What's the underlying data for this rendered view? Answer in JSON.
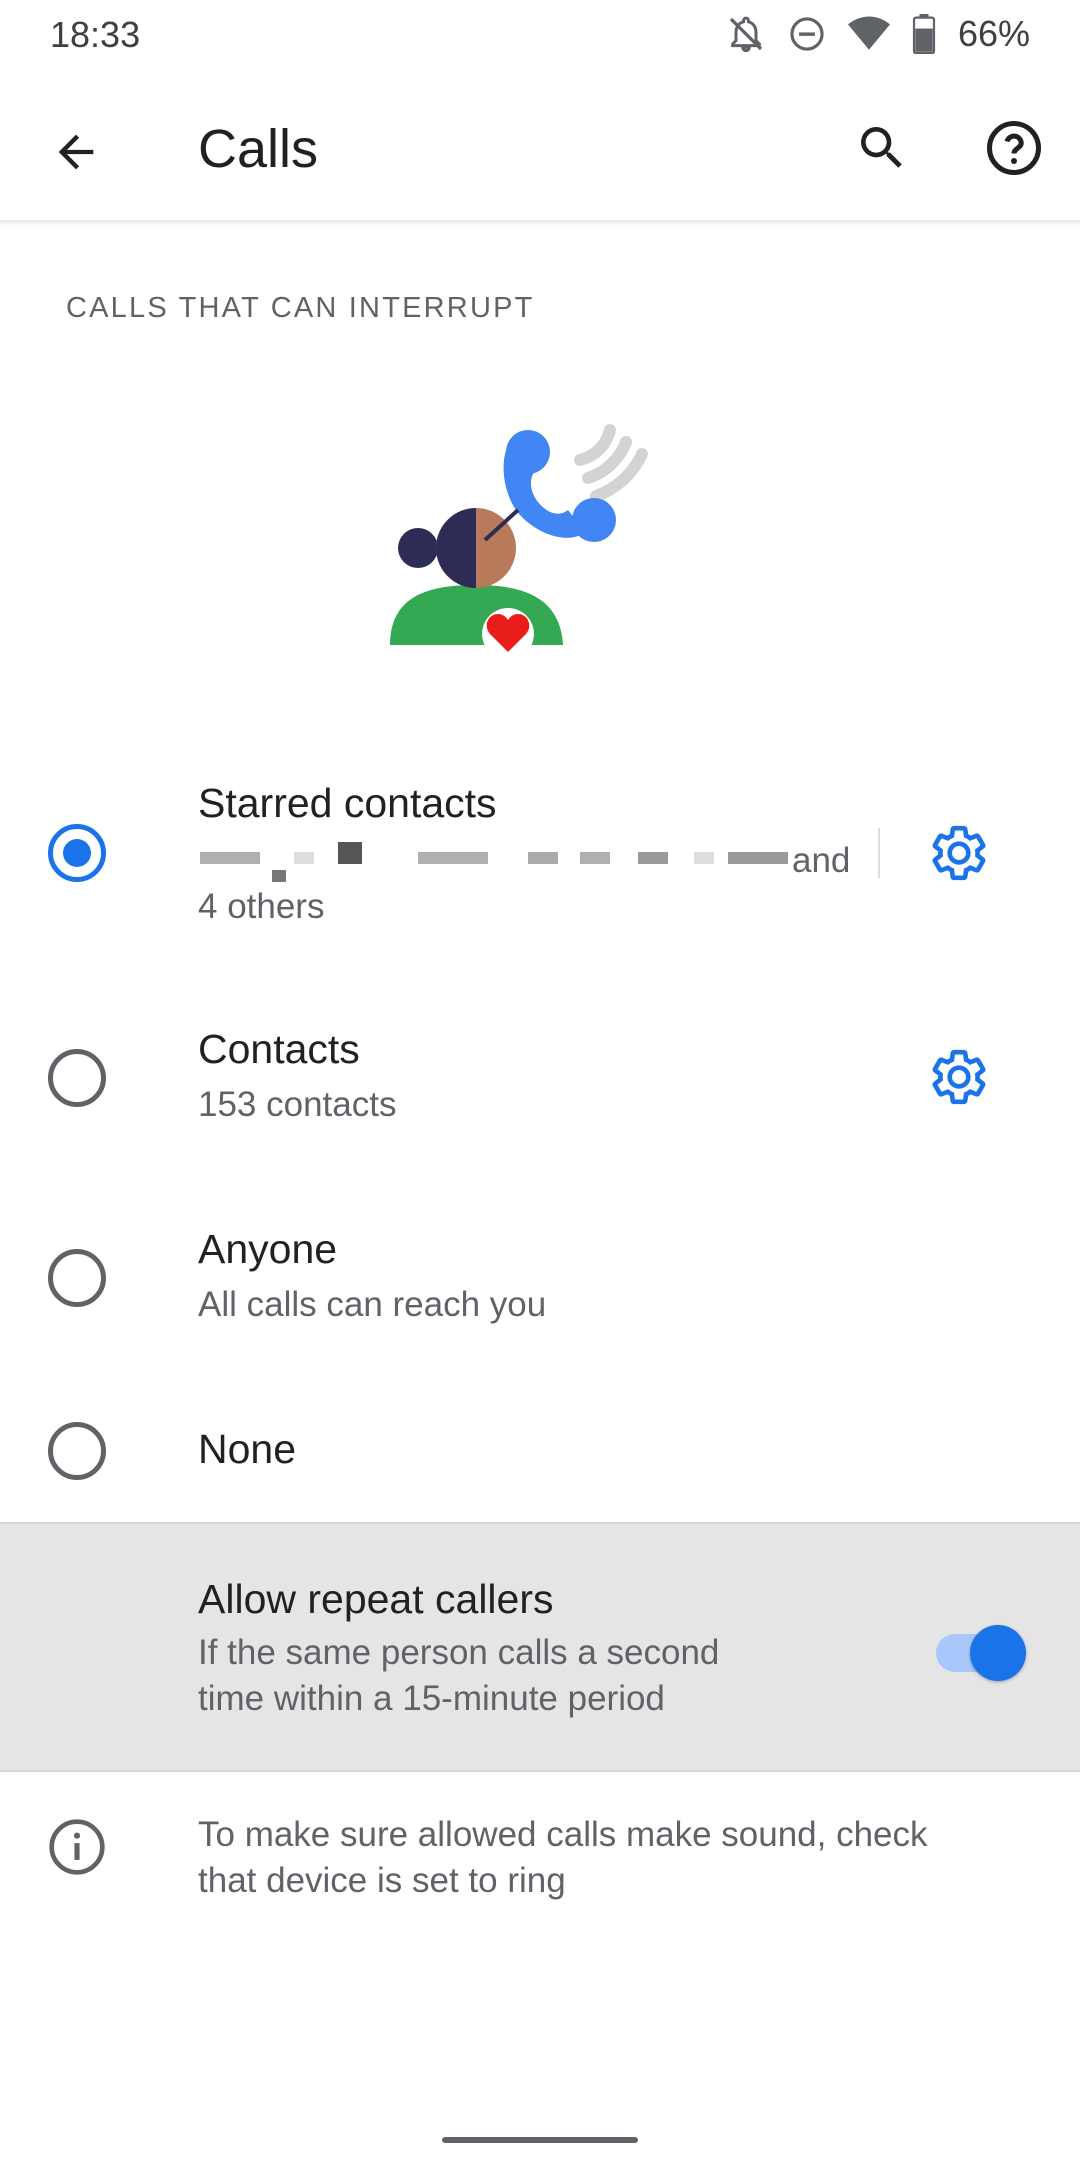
{
  "status_bar": {
    "time": "18:33",
    "battery": "66%",
    "icons": [
      "notifications-off-icon",
      "do-not-disturb-icon",
      "wifi-icon",
      "battery-icon"
    ]
  },
  "app_bar": {
    "title": "Calls",
    "icons": [
      "back-arrow-icon",
      "search-icon",
      "help-icon"
    ]
  },
  "section_header": "CALLS THAT CAN INTERRUPT",
  "options": [
    {
      "title": "Starred contacts",
      "subtitle_end": "and",
      "subtitle_line2": "4 others",
      "selected": true,
      "has_settings": true
    },
    {
      "title": "Contacts",
      "subtitle": "153 contacts",
      "selected": false,
      "has_settings": true
    },
    {
      "title": "Anyone",
      "subtitle": "All calls can reach you",
      "selected": false,
      "has_settings": false
    },
    {
      "title": "None",
      "selected": false,
      "has_settings": false
    }
  ],
  "repeat_callers": {
    "title": "Allow repeat callers",
    "subtitle_line1": "If the same person calls a second",
    "subtitle_line2": "time within a 15-minute period",
    "enabled": true
  },
  "info": {
    "line1": "To make sure allowed calls make sound, check",
    "line2": "that device is set to ring"
  },
  "colors": {
    "accent": "#1a73e8",
    "switch_track": "#a8c7fa",
    "highlight_bg": "#e5e5e5",
    "secondary_text": "#5f6368"
  }
}
